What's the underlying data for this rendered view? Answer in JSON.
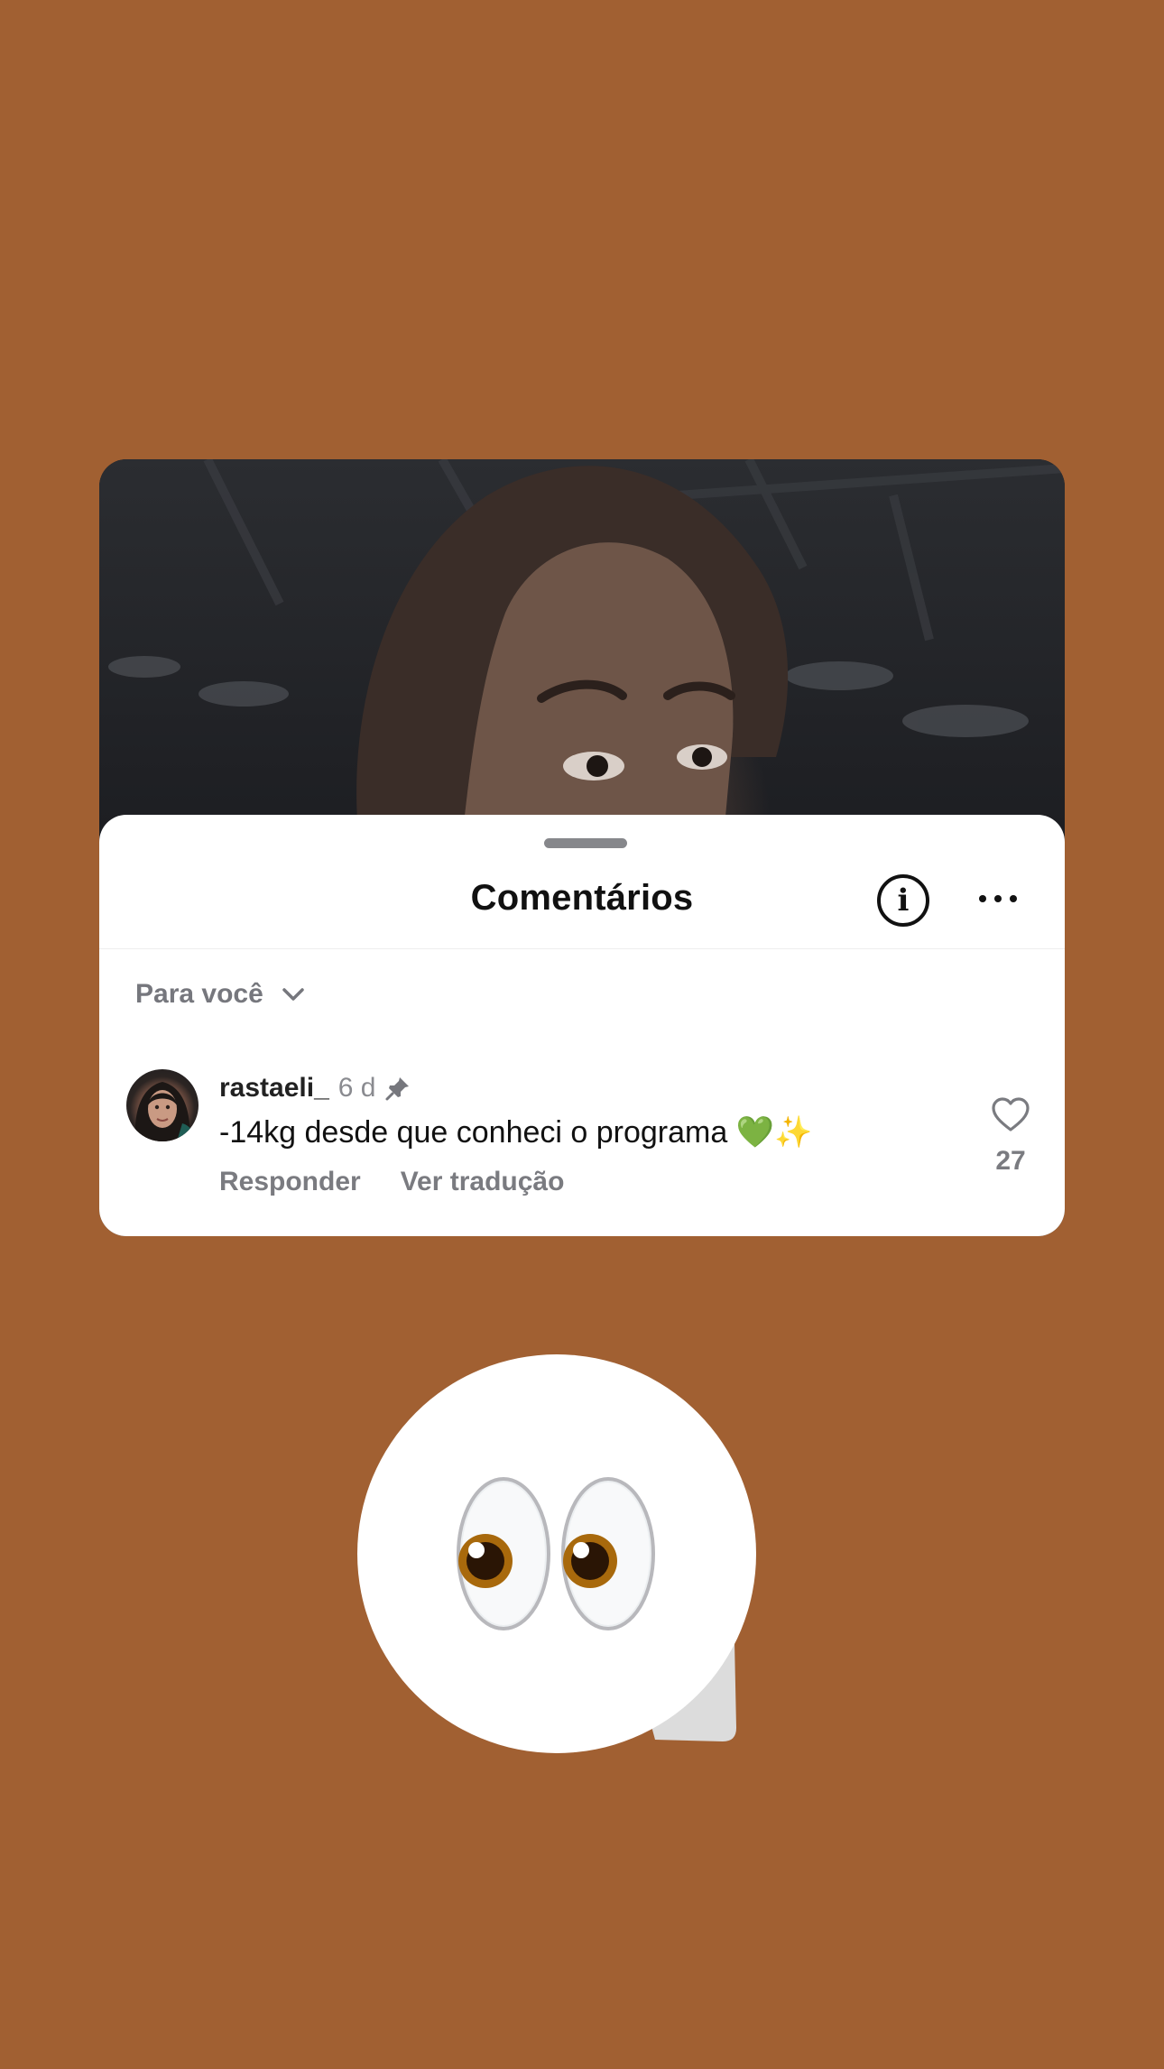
{
  "sheet": {
    "title": "Comentários",
    "info_icon": "info-circle-icon",
    "more_icon": "ellipsis-icon"
  },
  "filter": {
    "label": "Para você",
    "icon": "chevron-down-icon"
  },
  "comment": {
    "username": "rastaeli_",
    "timestamp": "6 d",
    "pinned_icon": "pin-icon",
    "text": "-14kg desde que conheci o programa 💚✨",
    "reply_label": "Responder",
    "translate_label": "Ver tradução",
    "like_icon": "heart-outline-icon",
    "like_count": "27"
  },
  "sticker": {
    "emoji": "👀",
    "icon": "eyes-emoji-sticker"
  },
  "colors": {
    "background": "#a16032",
    "sheet": "#ffffff",
    "secondary_text": "#7a7b80"
  }
}
